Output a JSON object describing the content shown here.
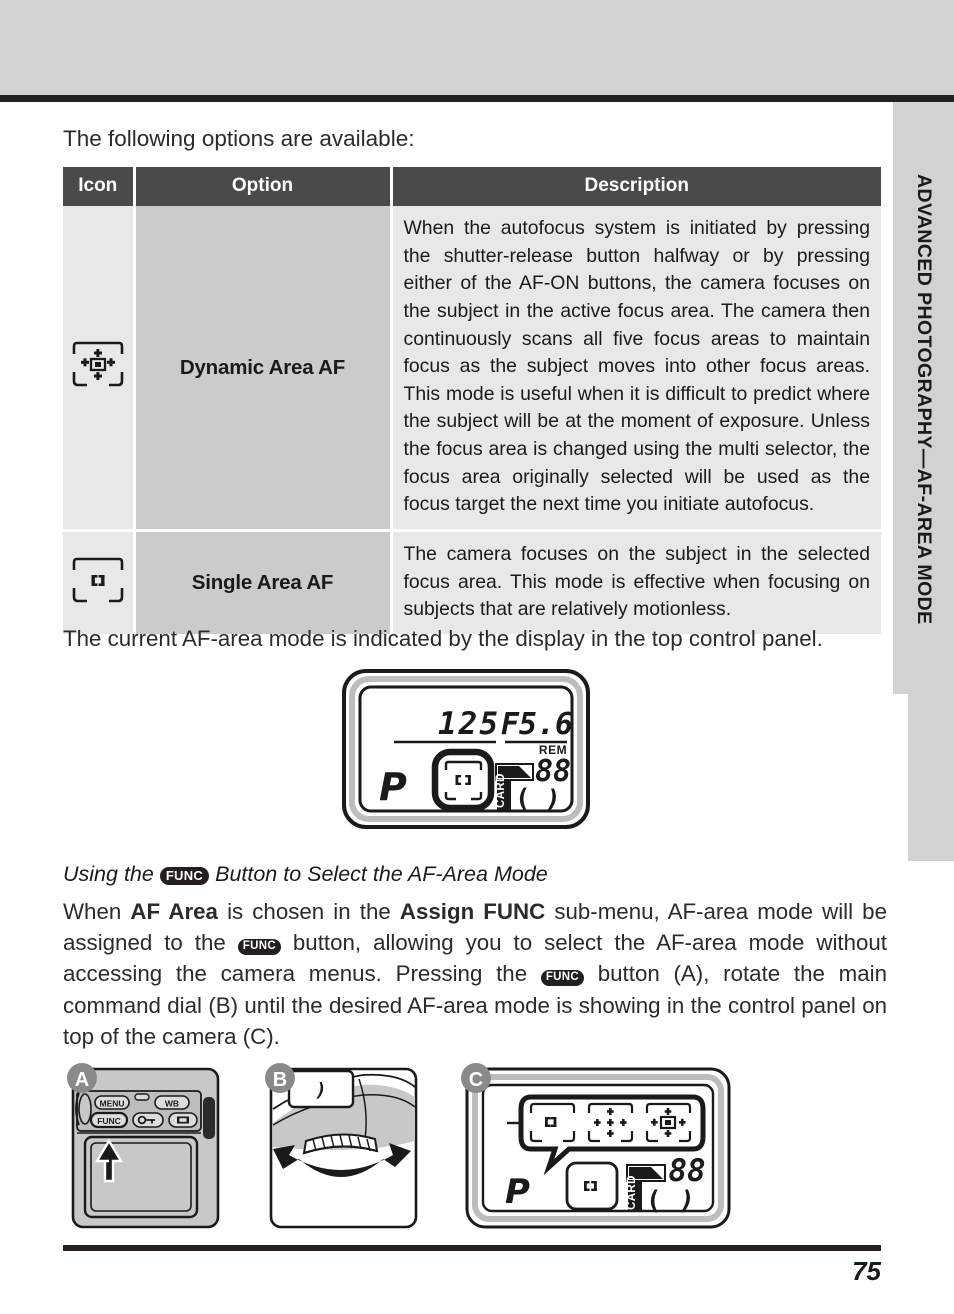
{
  "page": {
    "number": "75",
    "side_tab_label": "ADVANCED PHOTOGRAPHY—AF-AREA MODE"
  },
  "intro": {
    "line": "The following options are available:"
  },
  "options_table": {
    "headers": [
      "Icon",
      "Option",
      "Description"
    ],
    "rows": [
      {
        "icon_name": "dynamic-area-af-icon",
        "option": "Dynamic Area  AF",
        "description": "When the autofocus system is initiated by pressing the shutter-release button halfway or by pressing either of the AF-ON buttons, the camera focuses on the subject in the active focus area. The camera then continuously scans all five focus areas to maintain focus as the subject moves into other focus areas. This mode is useful when it is difficult to predict where the subject will be at the moment of exposure.  Unless the focus area is changed using the multi selector, the focus area originally selected will be used as the focus target the next time you initiate autofocus."
      },
      {
        "icon_name": "single-area-af-icon",
        "option": "Single Area AF",
        "description": "The camera focuses on the subject in the selected focus area.  This mode is effective when focusing on subjects that are relatively motionless."
      }
    ]
  },
  "body": {
    "current_mode_line": "The current AF-area mode is indicated by the display in the top control panel.",
    "sub_head_prefix": "Using the ",
    "sub_head_badge": "FUNC",
    "sub_head_suffix": " Button to Select the AF-Area Mode",
    "func_para": {
      "t1": "When ",
      "b1": "AF Area",
      "t2": " is chosen in the ",
      "b2": "Assign FUNC",
      "t3": " sub-menu, AF-area mode will be assigned to the ",
      "badge1": "FUNC",
      "t4": " button, allowing you to select the AF-area mode without accessing the camera menus.  Pressing the ",
      "badge2": "FUNC",
      "t5": " button (A), rotate the main command dial (B) until the desired AF-area mode is showing in the control panel on top of the camera (C)."
    }
  },
  "lcd_panel": {
    "shutter_speed": "125",
    "aperture_prefix": "F",
    "aperture": "5.6",
    "exposure_mode": "P",
    "rem_label": "REM",
    "frames_remaining": "88",
    "card_label": "CARD",
    "focus_bracket": "[ ]"
  },
  "illustrations": [
    {
      "badge": "A",
      "name": "camera-back-func-button",
      "buttons": [
        "MENU",
        "WB",
        "FUNC"
      ],
      "icon_names": [
        "menu-button",
        "wb-button",
        "func-button",
        "key-lock-button",
        "thumbnail-button",
        "up-arrow-pointer-icon"
      ]
    },
    {
      "badge": "B",
      "name": "main-command-dial-rotate",
      "icon_names": [
        "command-dial",
        "rotate-arrow-icon"
      ]
    },
    {
      "badge": "C",
      "name": "control-panel-af-area-callout",
      "callout_icons": [
        "single-area-af-icon",
        "dynamic-area-af-icon-5pt",
        "dynamic-area-af-icon"
      ],
      "exposure_mode": "P",
      "frames_remaining": "88",
      "card_label": "CARD"
    }
  ],
  "colors": {
    "band": "#d2d2d2",
    "rule": "#231f20",
    "table_header_bg": "#4a4a4a",
    "cell_light": "#e8e8e8",
    "cell_mid": "#cbcbcb",
    "text": "#1a1a1a"
  }
}
